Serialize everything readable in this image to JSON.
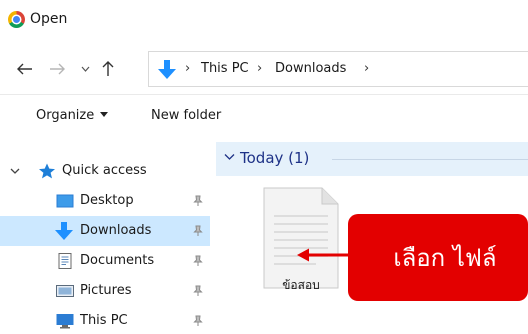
{
  "window": {
    "title": "Open",
    "app_icon": "chrome-icon"
  },
  "navigation": {
    "back_icon": "arrow-left-icon",
    "forward_icon": "arrow-right-icon",
    "recent_icon": "chevron-down-icon",
    "up_icon": "arrow-up-icon",
    "address": {
      "location_icon": "downloads-icon",
      "separator": "›",
      "segments": [
        "This PC",
        "Downloads"
      ]
    }
  },
  "toolbar": {
    "organize_label": "Organize",
    "new_folder_label": "New folder"
  },
  "sidebar": {
    "items": [
      {
        "label": "Quick access",
        "icon": "star-icon",
        "expanded": true
      },
      {
        "label": "Desktop",
        "icon": "desktop-folder-icon",
        "pinned": true
      },
      {
        "label": "Downloads",
        "icon": "downloads-folder-icon",
        "pinned": true,
        "selected": true
      },
      {
        "label": "Documents",
        "icon": "documents-folder-icon",
        "pinned": true
      },
      {
        "label": "Pictures",
        "icon": "pictures-folder-icon",
        "pinned": true
      },
      {
        "label": "This PC",
        "icon": "computer-icon",
        "pinned": true
      }
    ]
  },
  "content": {
    "group": {
      "label": "Today (1)",
      "expanded": true
    },
    "files": [
      {
        "name": "ข้อสอบ",
        "icon": "document-file-icon"
      }
    ]
  },
  "annotation": {
    "label": "เลือก ไฟล์",
    "color": "#e30000",
    "arrow_icon": "arrow-left-icon"
  },
  "colors": {
    "selection": "#cce8ff",
    "group_header": "#e5f1fb",
    "accent_blue": "#1e90ff"
  }
}
